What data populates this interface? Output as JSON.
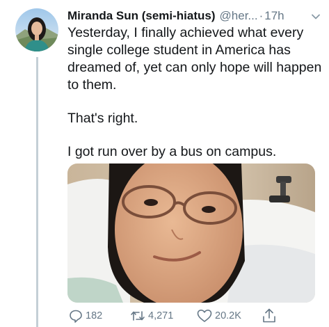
{
  "tweet": {
    "display_name": "Miranda Sun (semi-hiatus)",
    "handle": "@her...",
    "separator": "·",
    "timestamp": "17h",
    "text": {
      "line1": "Yesterday, I finally achieved what every single college student in America has dreamed of, yet can only hope will happen to them.",
      "line2": "That's right.",
      "line3": "I got run over by a bus on campus."
    }
  },
  "actions": {
    "reply_count": "182",
    "retweet_count": "4,271",
    "like_count": "20.2K"
  },
  "icons": {
    "reply": "reply-icon",
    "retweet": "retweet-icon",
    "like": "heart-icon",
    "share": "share-icon",
    "menu": "chevron-down-icon"
  },
  "colors": {
    "text": "#14171a",
    "secondary": "#657786",
    "thread_line": "#c4cfd6"
  }
}
